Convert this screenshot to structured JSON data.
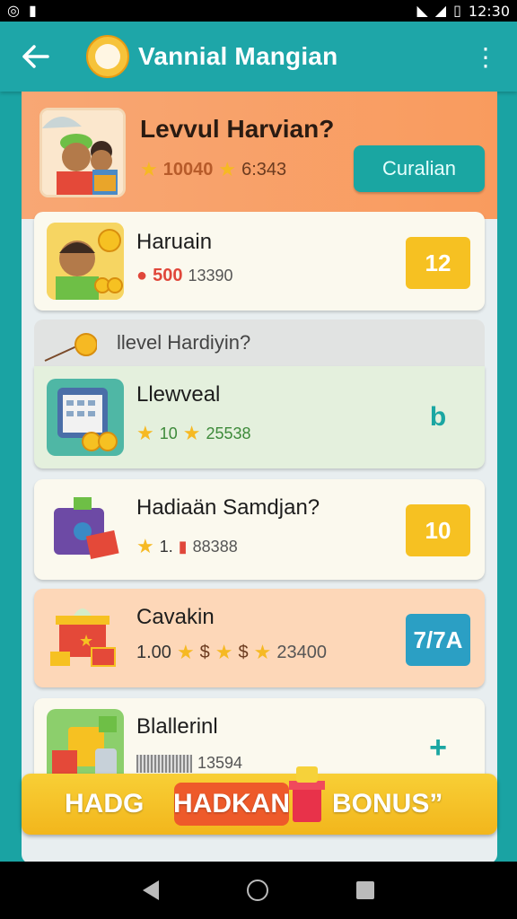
{
  "status": {
    "time": "12:30"
  },
  "app_bar": {
    "title": "Vannial Mangian"
  },
  "hero": {
    "title": "Levvul Harvian?",
    "stat1": "10040",
    "stat2": "6:343",
    "button": "Curalian"
  },
  "items": [
    {
      "title": "Haruain",
      "stat1": "500",
      "stat2": "13390",
      "badge": "12",
      "badge_color": "#f6c122"
    },
    {
      "title": "Llewveal",
      "stat1": "10",
      "stat2": "25538",
      "badge": "b",
      "badge_color": "transparent"
    },
    {
      "title": "Hadiaän Samdjan?",
      "stat1": "1.",
      "stat2": "88388",
      "badge": "10",
      "badge_color": "#f6c122"
    },
    {
      "title": "Cavakin",
      "stat1": "1.00",
      "stat2": "23400",
      "badge": "7/7A",
      "badge_color": "#2b9fc4"
    },
    {
      "title": "Blallerinl",
      "stat1": "",
      "stat2": "13594",
      "badge": "+",
      "badge_color": "transparent"
    }
  ],
  "section": {
    "title": "llevel Hardiyin?"
  },
  "banner": {
    "left": "HADG",
    "center": "HADKAN",
    "right": "BONUS”"
  }
}
